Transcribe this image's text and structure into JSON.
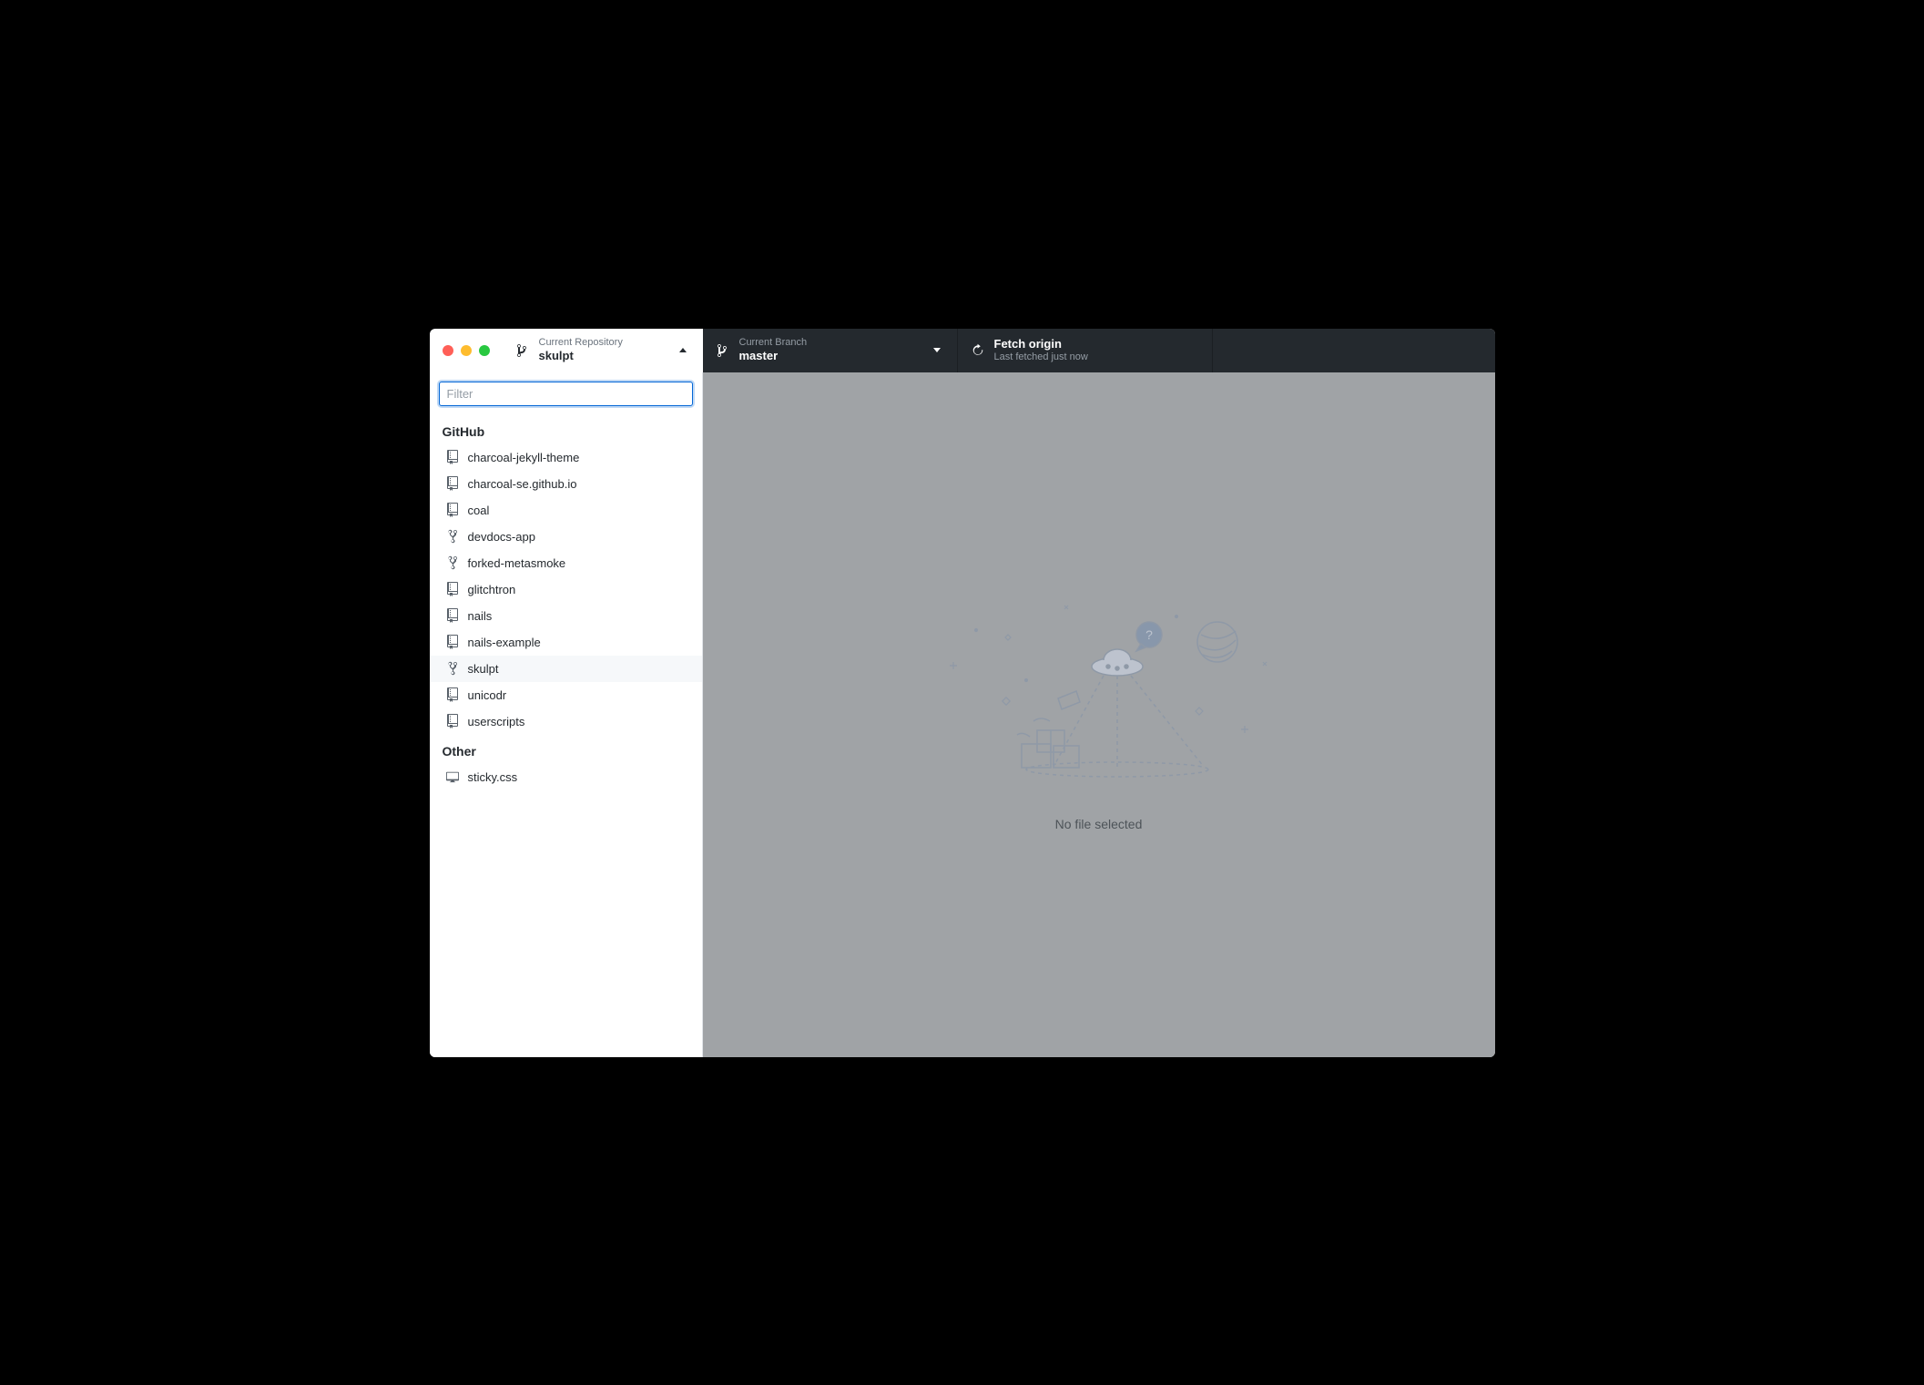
{
  "toolbar": {
    "repo": {
      "label": "Current Repository",
      "value": "skulpt"
    },
    "branch": {
      "label": "Current Branch",
      "value": "master"
    },
    "fetch": {
      "label": "Fetch origin",
      "value": "Last fetched just now"
    }
  },
  "filter": {
    "placeholder": "Filter"
  },
  "groups": [
    {
      "title": "GitHub",
      "items": [
        {
          "name": "charcoal-jekyll-theme",
          "icon": "repo",
          "selected": false
        },
        {
          "name": "charcoal-se.github.io",
          "icon": "repo",
          "selected": false
        },
        {
          "name": "coal",
          "icon": "repo",
          "selected": false
        },
        {
          "name": "devdocs-app",
          "icon": "fork",
          "selected": false
        },
        {
          "name": "forked-metasmoke",
          "icon": "fork",
          "selected": false
        },
        {
          "name": "glitchtron",
          "icon": "repo",
          "selected": false
        },
        {
          "name": "nails",
          "icon": "repo",
          "selected": false
        },
        {
          "name": "nails-example",
          "icon": "repo",
          "selected": false
        },
        {
          "name": "skulpt",
          "icon": "fork",
          "selected": true
        },
        {
          "name": "unicodr",
          "icon": "repo",
          "selected": false
        },
        {
          "name": "userscripts",
          "icon": "repo",
          "selected": false
        }
      ]
    },
    {
      "title": "Other",
      "items": [
        {
          "name": "sticky.css",
          "icon": "computer",
          "selected": false
        }
      ]
    }
  ],
  "main": {
    "empty_text": "No file selected"
  },
  "colors": {
    "accent": "#0366d6",
    "dark": "#24292e",
    "muted": "#959da5"
  }
}
